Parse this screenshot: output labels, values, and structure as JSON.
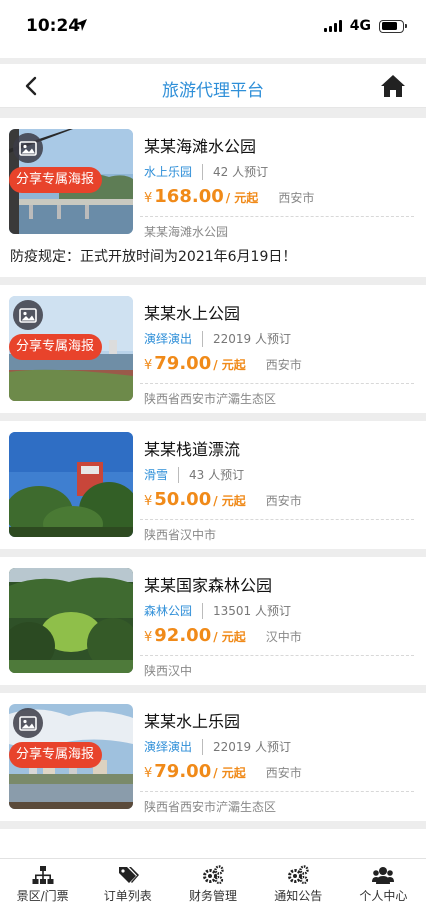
{
  "status_bar": {
    "time": "10:24",
    "network": "4G",
    "battery_level": 0.75
  },
  "nav": {
    "title": "旅游代理平台",
    "back_icon": "chevron-left-icon",
    "home_icon": "home-icon"
  },
  "share_label": "分享专属海报",
  "price_unit": "/ 元起",
  "currency": "¥",
  "cards": [
    {
      "title": "某某海滩水公园",
      "category": "水上乐园",
      "count": "42 人预订",
      "price": "168.00",
      "city": "西安市",
      "address": "某某海滩水公园",
      "notice": "防疫规定：正式开放时间为2021年6月19日！",
      "has_share": true
    },
    {
      "title": "某某水上公园",
      "category": "演绎演出",
      "count": "22019 人预订",
      "price": "79.00",
      "city": "西安市",
      "address": "陕西省西安市浐灞生态区",
      "has_share": true
    },
    {
      "title": "某某栈道漂流",
      "category": "滑雪",
      "count": "43 人预订",
      "price": "50.00",
      "city": "西安市",
      "address": "陕西省汉中市",
      "has_share": false
    },
    {
      "title": "某某国家森林公园",
      "category": "森林公园",
      "count": "13501 人预订",
      "price": "92.00",
      "city": "汉中市",
      "address": "陕西汉中",
      "has_share": false
    },
    {
      "title": "某某水上乐园",
      "category": "演绎演出",
      "count": "22019 人预订",
      "price": "79.00",
      "city": "西安市",
      "address": "陕西省西安市浐灞生态区",
      "has_share": true
    }
  ],
  "tabs": [
    {
      "label": "景区/门票",
      "icon": "sitemap-icon"
    },
    {
      "label": "订单列表",
      "icon": "tags-icon"
    },
    {
      "label": "财务管理",
      "icon": "gears-icon"
    },
    {
      "label": "通知公告",
      "icon": "gears-icon"
    },
    {
      "label": "个人中心",
      "icon": "users-icon"
    }
  ],
  "colors": {
    "accent": "#2f8fd8",
    "price": "#f08a19",
    "share_tag": "#e8432b"
  }
}
